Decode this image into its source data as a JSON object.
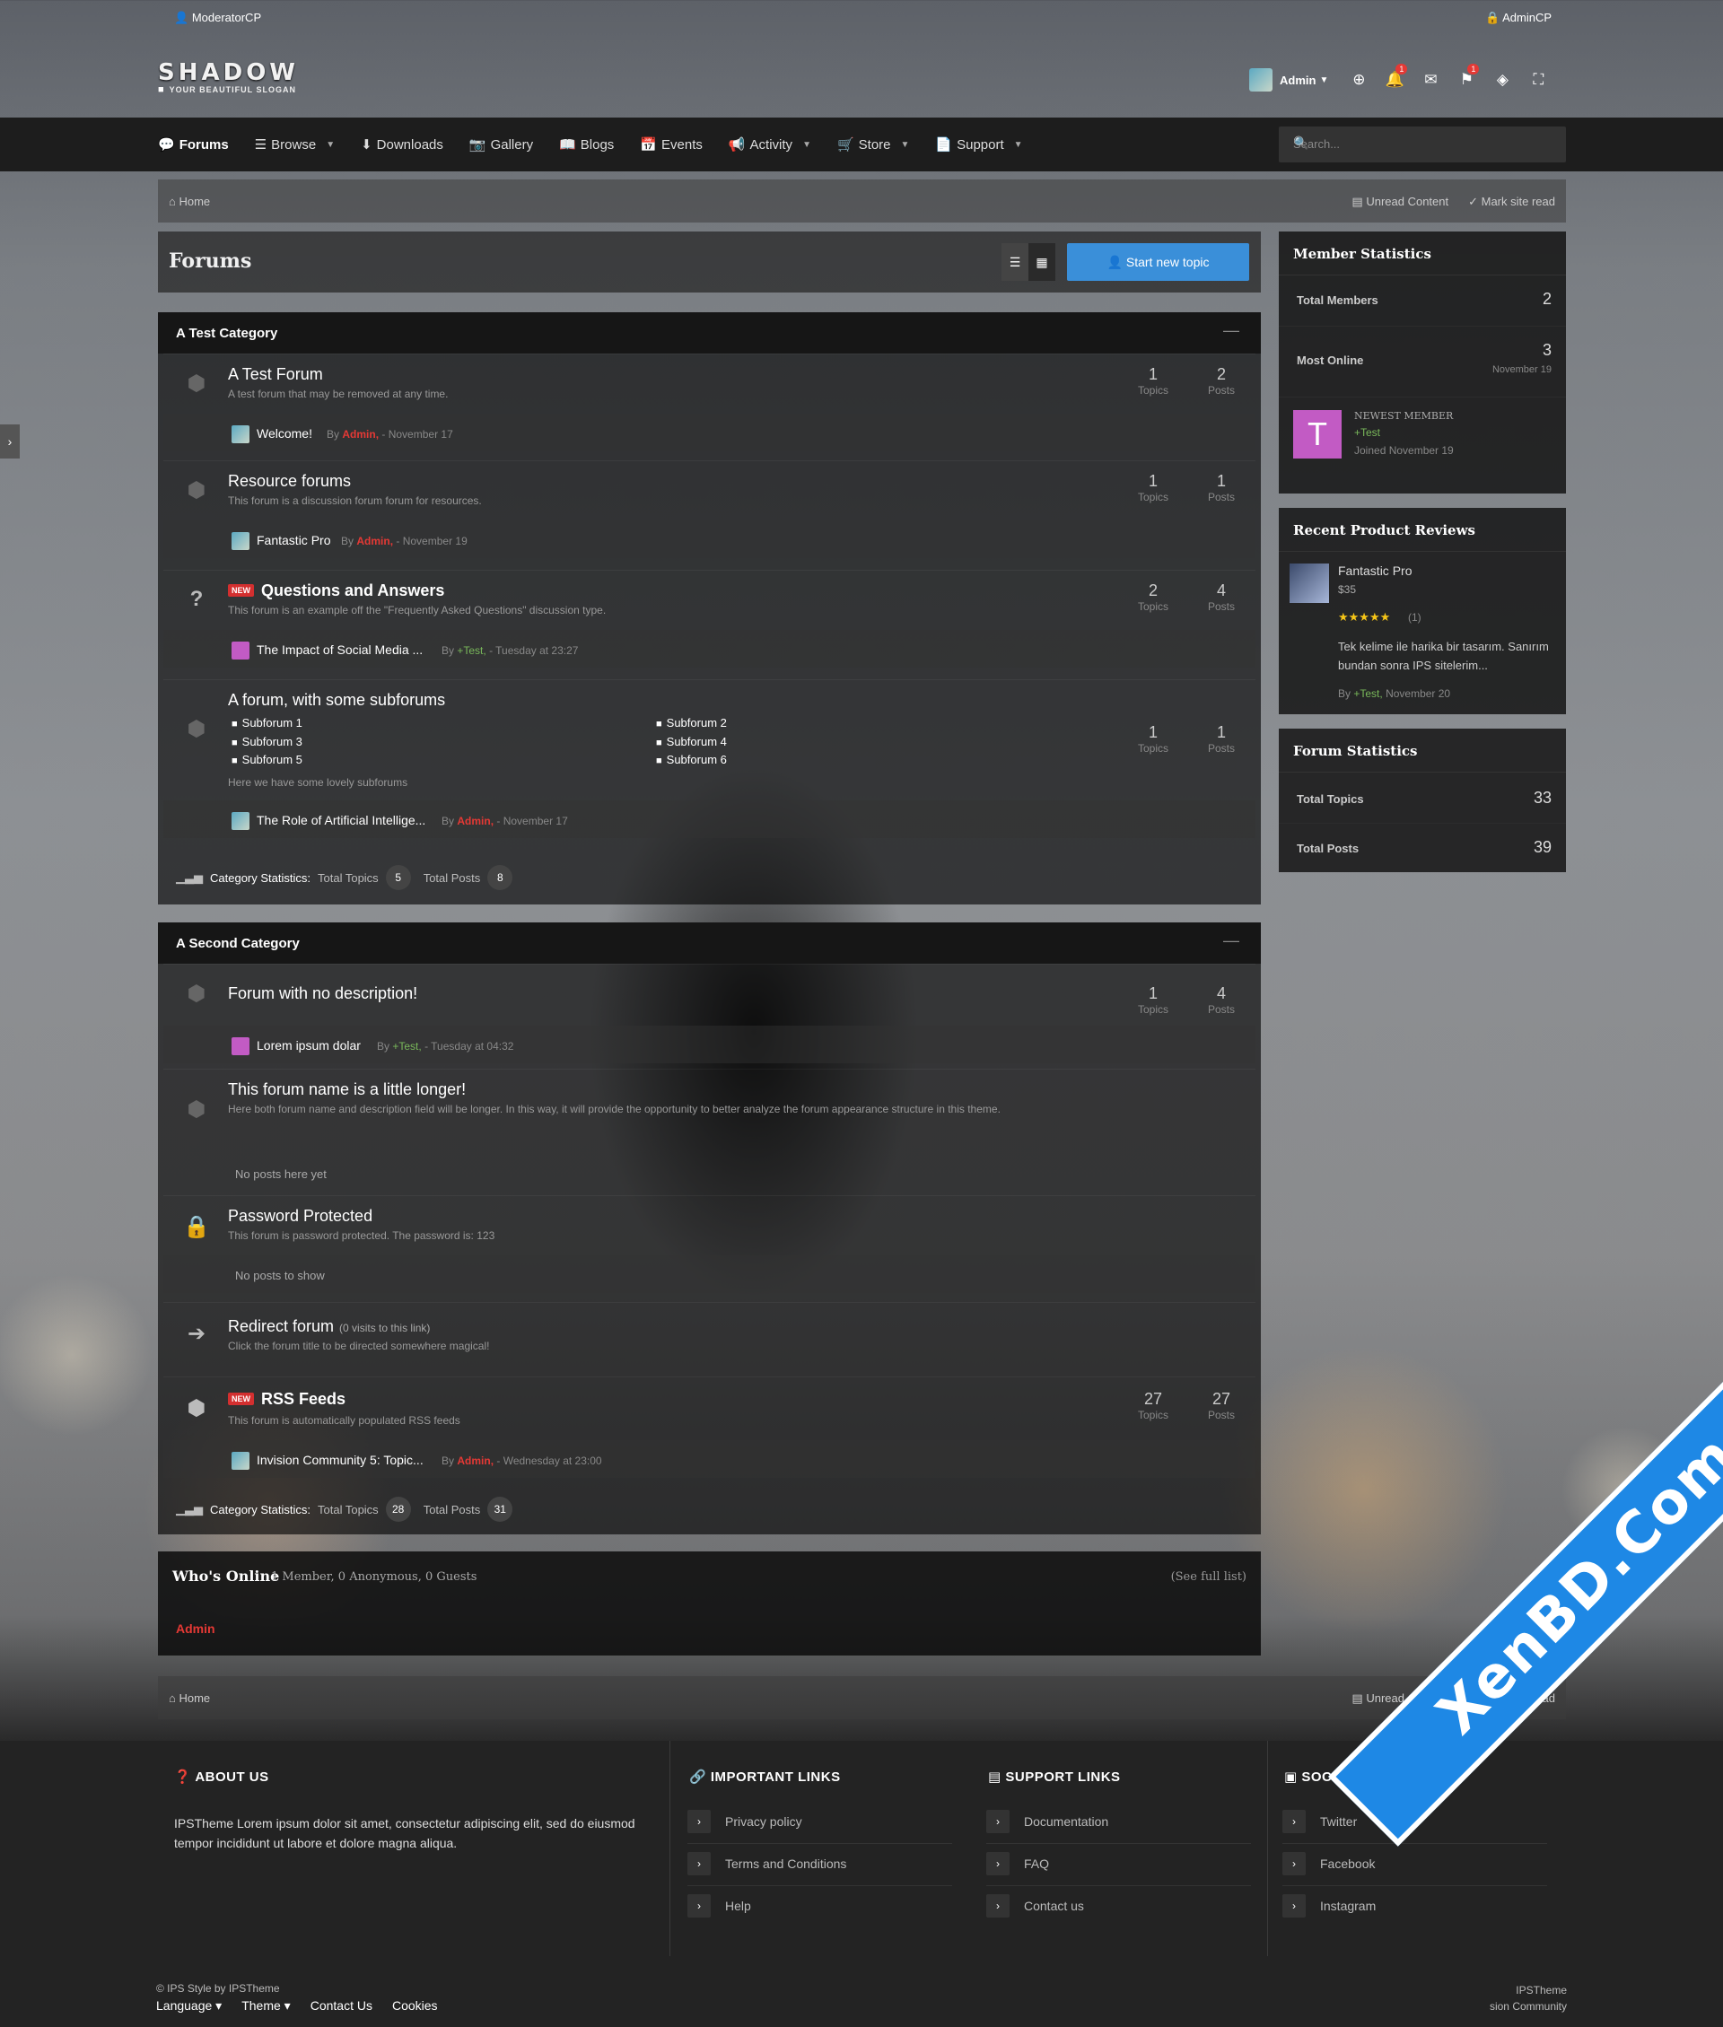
{
  "topbar": {
    "moderator": "ModeratorCP",
    "admin": "AdminCP"
  },
  "logo": {
    "name": "SHADOW",
    "slogan": "YOUR BEAUTIFUL SLOGAN"
  },
  "user": {
    "name": "Admin",
    "notifications": "1",
    "reports": "1"
  },
  "nav": {
    "items": [
      "Forums",
      "Browse",
      "Downloads",
      "Gallery",
      "Blogs",
      "Events",
      "Activity",
      "Store",
      "Support"
    ],
    "search_placeholder": "Search..."
  },
  "breadcrumb": {
    "home": "Home",
    "unread": "Unread Content",
    "mark_read": "Mark site read"
  },
  "page": {
    "title": "Forums",
    "new_topic": "Start new topic"
  },
  "categories": [
    {
      "title": "A Test Category",
      "forums": [
        {
          "title": "A Test Forum",
          "desc": "A test forum that may be removed at any time.",
          "topics": "1",
          "posts": "2",
          "topics_label": "Topics",
          "posts_label": "Posts",
          "last_title": "Welcome!",
          "last_by": "By",
          "last_user": "Admin,",
          "last_date": "- November 17"
        },
        {
          "title": "Resource forums",
          "desc": "This forum is a discussion forum forum for resources.",
          "topics": "1",
          "posts": "1",
          "topics_label": "Topics",
          "posts_label": "Posts",
          "last_title": "Fantastic Pro",
          "last_by": "By",
          "last_user": "Admin,",
          "last_date": "- November 19"
        },
        {
          "badge": "NEW",
          "title": "Questions and Answers",
          "desc": "This forum is an example off the \"Frequently Asked Questions\" discussion type.",
          "topics": "2",
          "posts": "4",
          "topics_label": "Topics",
          "posts_label": "Posts",
          "last_title": "The Impact of Social Media ...",
          "last_by": "By",
          "last_user": "+Test,",
          "last_date": "- Tuesday at 23:27"
        },
        {
          "title": "A forum, with some subforums",
          "desc": "Here we have some lovely subforums",
          "topics": "1",
          "posts": "1",
          "topics_label": "Topics",
          "posts_label": "Posts",
          "subforums": [
            "Subforum 1",
            "Subforum 2",
            "Subforum 3",
            "Subforum 4",
            "Subforum 5",
            "Subforum 6"
          ],
          "last_title": "The Role of Artificial Intellige...",
          "last_by": "By",
          "last_user": "Admin,",
          "last_date": "- November 17"
        }
      ],
      "stats_label": "Category Statistics:",
      "topics_label": "Total Topics",
      "topics": "5",
      "posts_label": "Total Posts",
      "posts": "8"
    },
    {
      "title": "A Second Category",
      "forums": [
        {
          "title": "Forum with no description!",
          "topics": "1",
          "posts": "4",
          "topics_label": "Topics",
          "posts_label": "Posts",
          "last_title": "Lorem ipsum dolar",
          "last_by": "By",
          "last_user": "+Test,",
          "last_date": "- Tuesday at 04:32"
        },
        {
          "title": "This forum name is a little longer!",
          "desc": "Here both forum name and description field will be longer. In this way, it will provide the opportunity to better analyze the forum appearance structure in this theme.",
          "none": "No posts here yet"
        },
        {
          "title": "Password Protected",
          "desc": "This forum is password protected. The password is: 123",
          "none": "No posts to show"
        },
        {
          "title": "Redirect forum",
          "extra": "(0 visits to this link)",
          "desc": "Click the forum title to be directed somewhere magical!"
        },
        {
          "badge": "NEW",
          "title": "RSS Feeds",
          "desc": "This forum is automatically populated RSS feeds",
          "topics": "27",
          "posts": "27",
          "topics_label": "Topics",
          "posts_label": "Posts",
          "last_title": "Invision Community 5: Topic...",
          "last_by": "By",
          "last_user": "Admin,",
          "last_date": "- Wednesday at 23:00"
        }
      ],
      "stats_label": "Category Statistics:",
      "topics_label": "Total Topics",
      "topics": "28",
      "posts_label": "Total Posts",
      "posts": "31"
    }
  ],
  "sidebar": {
    "member_stats": {
      "title": "Member Statistics",
      "total_label": "Total Members",
      "total": "2",
      "online_label": "Most Online",
      "online": "3",
      "online_date": "November 19",
      "newest_label": "NEWEST MEMBER",
      "newest_name": "+Test",
      "newest_joined": "Joined November 19",
      "newest_initial": "T"
    },
    "reviews": {
      "title": "Recent Product Reviews",
      "product": "Fantastic Pro",
      "price": "$35",
      "stars": "★★★★★",
      "count": "(1)",
      "text": "Tek kelime ile harika bir tasarım. Sanırım bundan sonra IPS sitelerim...",
      "by": "By",
      "user": "+Test,",
      "date": "November 20"
    },
    "forum_stats": {
      "title": "Forum Statistics",
      "topics_label": "Total Topics",
      "topics": "33",
      "posts_label": "Total Posts",
      "posts": "39"
    }
  },
  "whos_online": {
    "title": "Who's Online",
    "summary": "1 Member, 0 Anonymous, 0 Guests",
    "full": "(See full list)",
    "user": "Admin"
  },
  "footer": {
    "about": {
      "title": "ABOUT US",
      "text": "IPSTheme Lorem ipsum dolor sit amet, consectetur adipiscing elit, sed do eiusmod tempor incididunt ut labore et dolore magna aliqua."
    },
    "important": {
      "title": "IMPORTANT LINKS",
      "links": [
        "Privacy policy",
        "Terms and Conditions",
        "Help"
      ]
    },
    "support": {
      "title": "SUPPORT LINKS",
      "links": [
        "Documentation",
        "FAQ",
        "Contact us"
      ]
    },
    "social": {
      "title": "SOCIAL LINKS",
      "links": [
        "Twitter",
        "Facebook",
        "Instagram"
      ]
    },
    "copyright": "© IPS Style by IPSTheme",
    "bottom_links": [
      "Language",
      "Theme",
      "Contact Us",
      "Cookies"
    ],
    "powered": "IPSTheme",
    "powered2": "sion Community"
  },
  "watermark": "XenBD.Com"
}
